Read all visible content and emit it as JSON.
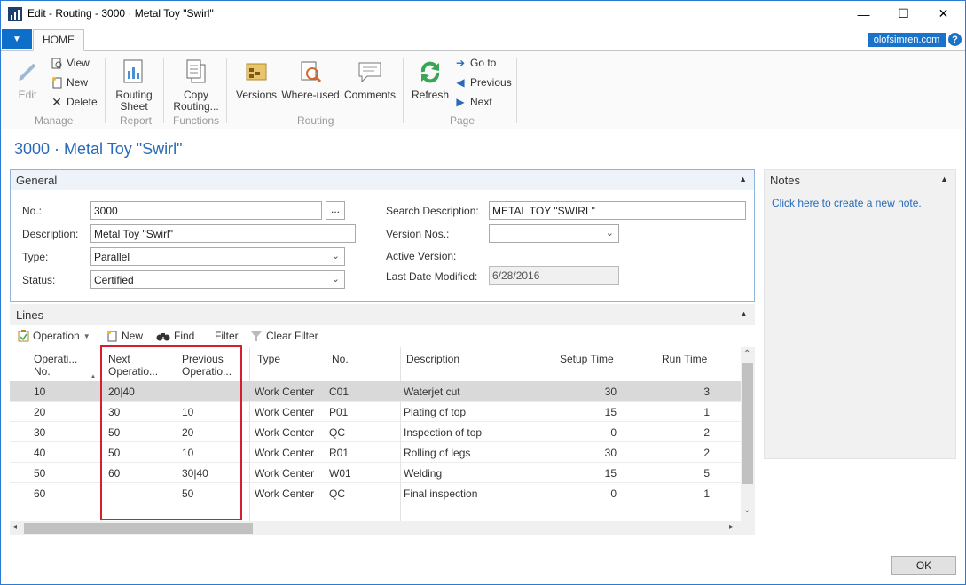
{
  "window": {
    "title": "Edit - Routing - 3000 · Metal Toy \"Swirl\"",
    "minimize": "—",
    "maximize": "☐",
    "close": "✕"
  },
  "ribbon": {
    "home_tab": "HOME",
    "brand": "olofsimren.com",
    "help": "?",
    "edit": "Edit",
    "view": "View",
    "new": "New",
    "delete": "Delete",
    "manage_label": "Manage",
    "routing_sheet_1": "Routing",
    "routing_sheet_2": "Sheet",
    "report_label": "Report",
    "copy_routing_1": "Copy",
    "copy_routing_2": "Routing...",
    "functions_label": "Functions",
    "versions": "Versions",
    "where_used": "Where-used",
    "comments": "Comments",
    "routing_label": "Routing",
    "refresh": "Refresh",
    "goto": "Go to",
    "previous": "Previous",
    "next": "Next",
    "page_label": "Page"
  },
  "page_title": "3000 · Metal Toy \"Swirl\"",
  "general": {
    "heading": "General",
    "no_label": "No.:",
    "no_value": "3000",
    "assist": "...",
    "description_label": "Description:",
    "description_value": "Metal Toy \"Swirl\"",
    "type_label": "Type:",
    "type_value": "Parallel",
    "status_label": "Status:",
    "status_value": "Certified",
    "search_description_label": "Search Description:",
    "search_description_value": "METAL TOY \"SWIRL\"",
    "version_nos_label": "Version Nos.:",
    "version_nos_value": "",
    "active_version_label": "Active Version:",
    "last_date_modified_label": "Last Date Modified:",
    "last_date_modified_value": "6/28/2016"
  },
  "notes": {
    "heading": "Notes",
    "link": "Click here to create a new note."
  },
  "lines": {
    "heading": "Lines",
    "toolbar": {
      "operation": "Operation",
      "new": "New",
      "find": "Find",
      "filter": "Filter",
      "clear_filter": "Clear Filter"
    },
    "columns": {
      "operation_no_1": "Operati...",
      "operation_no_2": "No.",
      "next_op_1": "Next",
      "next_op_2": "Operatio...",
      "prev_op_1": "Previous",
      "prev_op_2": "Operatio...",
      "type": "Type",
      "no": "No.",
      "description": "Description",
      "setup_time": "Setup Time",
      "run_time": "Run Time"
    },
    "rows": [
      {
        "op": "10",
        "next": "20|40",
        "prev": "",
        "type": "Work Center",
        "no": "C01",
        "desc": "Waterjet cut",
        "setup": "30",
        "run": "3"
      },
      {
        "op": "20",
        "next": "30",
        "prev": "10",
        "type": "Work Center",
        "no": "P01",
        "desc": "Plating of top",
        "setup": "15",
        "run": "1"
      },
      {
        "op": "30",
        "next": "50",
        "prev": "20",
        "type": "Work Center",
        "no": "QC",
        "desc": "Inspection of top",
        "setup": "0",
        "run": "2"
      },
      {
        "op": "40",
        "next": "50",
        "prev": "10",
        "type": "Work Center",
        "no": "R01",
        "desc": "Rolling of legs",
        "setup": "30",
        "run": "2"
      },
      {
        "op": "50",
        "next": "60",
        "prev": "30|40",
        "type": "Work Center",
        "no": "W01",
        "desc": "Welding",
        "setup": "15",
        "run": "5"
      },
      {
        "op": "60",
        "next": "",
        "prev": "50",
        "type": "Work Center",
        "no": "QC",
        "desc": "Final inspection",
        "setup": "0",
        "run": "1"
      }
    ]
  },
  "ok_button": "OK",
  "colors": {
    "accent": "#2a6ab8",
    "highlight_box": "#d3202c",
    "selected_row": "#d9d9d9"
  }
}
